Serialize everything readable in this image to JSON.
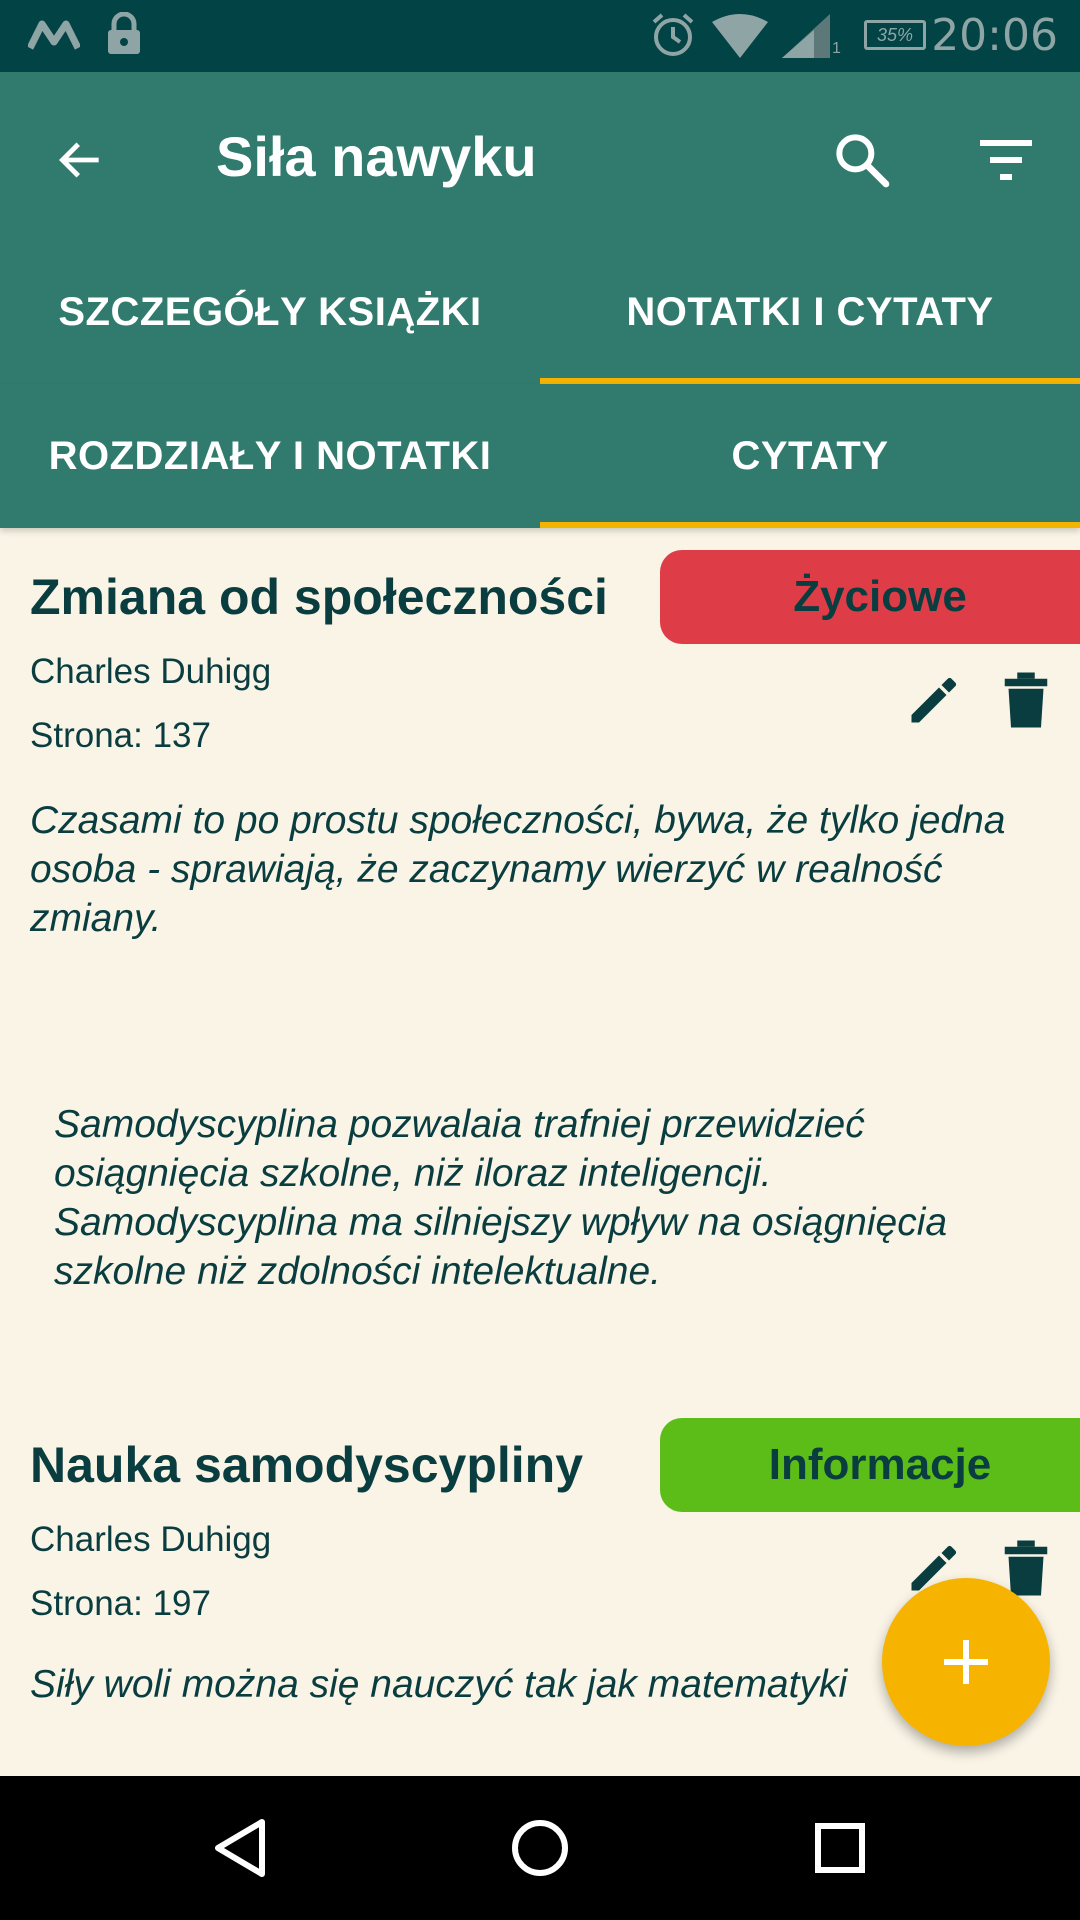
{
  "status_bar": {
    "time": "20:06",
    "battery": "35%",
    "signal_sub": "1"
  },
  "app_bar": {
    "title": "Siła nawyku",
    "back_icon": "arrow-left-icon",
    "search_icon": "search-icon",
    "filter_icon": "filter-icon"
  },
  "tabs": [
    {
      "label": "SZCZEGÓŁY KSIĄŻKI",
      "selected": false
    },
    {
      "label": "NOTATKI I CYTATY",
      "selected": true
    }
  ],
  "sub_tabs": [
    {
      "label": "ROZDZIAŁY I NOTATKI",
      "selected": false
    },
    {
      "label": "CYTATY",
      "selected": true
    }
  ],
  "quotes": [
    {
      "title": "Zmiana od społeczności",
      "tag": "Życiowe",
      "tag_color": "#de3d47",
      "author": "Charles Duhigg",
      "page": "Strona: 137",
      "text": "Czasami to po prostu społeczności, bywa, że tylko jedna osoba - sprawiają, że zaczynamy wierzyć w realność zmiany."
    },
    {
      "title": "",
      "text": "Samodyscyplina pozwalaia trafniej przewidzieć osiągnięcia szkolne, niż iloraz inteligencji. Samodyscyplina ma silniejszy wpływ na osiągnięcia szkolne niż zdolności intelektualne."
    },
    {
      "title": "Nauka samodyscypliny",
      "tag": "Informacje",
      "tag_color": "#5cbd18",
      "author": "Charles Duhigg",
      "page": "Strona: 197",
      "text": "Siły woli można się nauczyć tak jak matematyki"
    }
  ],
  "colors": {
    "primary": "#317b6e",
    "status_bar": "#024345",
    "accent": "#f3b400",
    "background": "#f9f4e6",
    "text": "#0a3d40"
  }
}
